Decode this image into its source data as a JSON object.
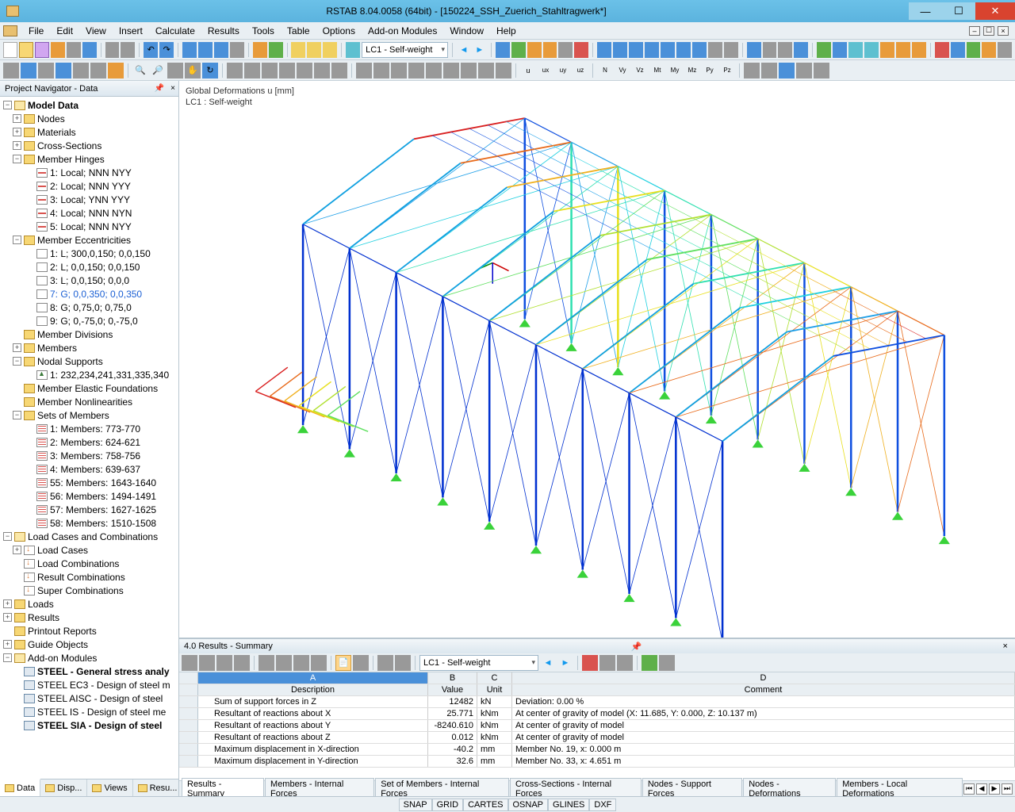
{
  "title": "RSTAB 8.04.0058 (64bit) - [150224_SSH_Zuerich_Stahltragwerk*]",
  "menu": [
    "File",
    "Edit",
    "View",
    "Insert",
    "Calculate",
    "Results",
    "Tools",
    "Table",
    "Options",
    "Add-on Modules",
    "Window",
    "Help"
  ],
  "toolbar1": {
    "loadcase": "LC1 - Self-weight"
  },
  "navigator": {
    "title": "Project Navigator - Data",
    "tabs": [
      "Data",
      "Disp...",
      "Views",
      "Resu..."
    ],
    "tree": {
      "model_data": "Model Data",
      "nodes": "Nodes",
      "materials": "Materials",
      "cross_sections": "Cross-Sections",
      "member_hinges": "Member Hinges",
      "hinge1": "1: Local; NNN NYY",
      "hinge2": "2: Local; NNN YYY",
      "hinge3": "3: Local; YNN YYY",
      "hinge4": "4: Local; NNN NYN",
      "hinge5": "5: Local; NNN NYY",
      "member_ecc": "Member Eccentricities",
      "ecc1": "1: L; 300,0,150; 0,0,150",
      "ecc2": "2: L; 0,0,150; 0,0,150",
      "ecc3": "3: L; 0,0,150; 0,0,0",
      "ecc7": "7: G; 0,0,350; 0,0,350",
      "ecc8": "8: G; 0,75,0; 0,75,0",
      "ecc9": "9: G; 0,-75,0; 0,-75,0",
      "member_div": "Member Divisions",
      "members": "Members",
      "nodal_supports": "Nodal Supports",
      "support1": "1: 232,234,241,331,335,340",
      "elastic_found": "Member Elastic Foundations",
      "nonlin": "Member Nonlinearities",
      "sets": "Sets of Members",
      "set1": "1: Members: 773-770",
      "set2": "2: Members: 624-621",
      "set3": "3: Members: 758-756",
      "set4": "4: Members: 639-637",
      "set55": "55: Members: 1643-1640",
      "set56": "56: Members: 1494-1491",
      "set57": "57: Members: 1627-1625",
      "set58": "58: Members: 1510-1508",
      "loadcases_comb": "Load Cases and Combinations",
      "load_cases": "Load Cases",
      "load_comb": "Load Combinations",
      "result_comb": "Result Combinations",
      "super_comb": "Super Combinations",
      "loads": "Loads",
      "results": "Results",
      "printout": "Printout Reports",
      "guide": "Guide Objects",
      "addon": "Add-on Modules",
      "steel": "STEEL - General stress analy",
      "ec3": "STEEL EC3 - Design of steel m",
      "aisc": "STEEL AISC - Design of steel",
      "is": "STEEL IS - Design of steel me",
      "sia": "STEEL SIA - Design of steel"
    }
  },
  "viewport": {
    "line1": "Global Deformations u [mm]",
    "line2": "LC1 : Self-weight"
  },
  "results": {
    "title": "4.0 Results - Summary",
    "loadcase": "LC1 - Self-weight",
    "cols": {
      "a": "A",
      "b": "B",
      "c": "C",
      "d": "D"
    },
    "headers": {
      "desc": "Description",
      "val": "Value",
      "unit": "Unit",
      "comment": "Comment"
    },
    "rows": [
      {
        "desc": "Sum of support forces in Z",
        "val": "12482",
        "unit": "kN",
        "comment": "Deviation:  0.00 %"
      },
      {
        "desc": "Resultant of reactions about X",
        "val": "25.771",
        "unit": "kNm",
        "comment": "At center of gravity of model (X: 11.685, Y: 0.000, Z: 10.137 m)"
      },
      {
        "desc": "Resultant of reactions about Y",
        "val": "-8240.610",
        "unit": "kNm",
        "comment": "At center of gravity of model"
      },
      {
        "desc": "Resultant of reactions about Z",
        "val": "0.012",
        "unit": "kNm",
        "comment": "At center of gravity of model"
      },
      {
        "desc": "Maximum displacement in X-direction",
        "val": "-40.2",
        "unit": "mm",
        "comment": "Member No. 19,  x: 0.000 m"
      },
      {
        "desc": "Maximum displacement in Y-direction",
        "val": "32.6",
        "unit": "mm",
        "comment": "Member No. 33,  x: 4.651 m"
      }
    ],
    "tabs": [
      "Results - Summary",
      "Members - Internal Forces",
      "Set of Members - Internal Forces",
      "Cross-Sections - Internal Forces",
      "Nodes - Support Forces",
      "Nodes - Deformations",
      "Members - Local Deformations"
    ]
  },
  "status": [
    "SNAP",
    "GRID",
    "CARTES",
    "OSNAP",
    "GLINES",
    "DXF"
  ]
}
